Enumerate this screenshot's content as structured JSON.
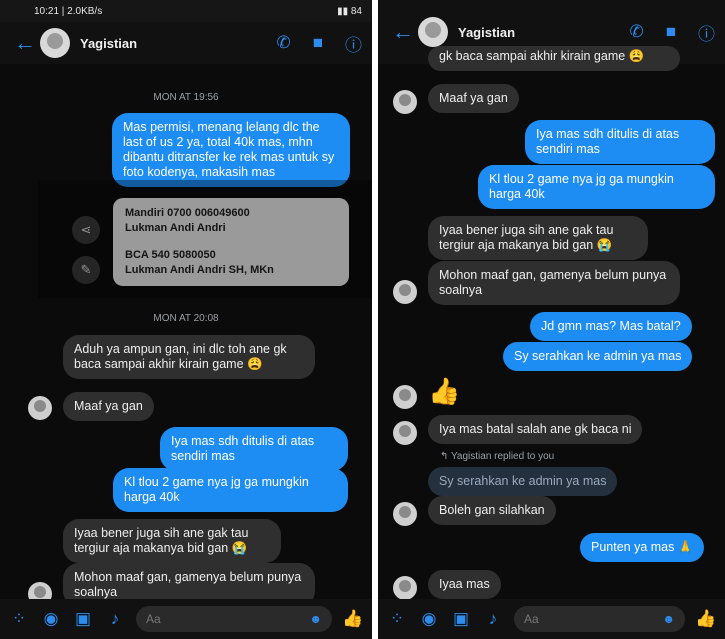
{
  "status": {
    "time": "10:21 | 2.0KB/s",
    "battery": "84"
  },
  "contact": {
    "name": "Yagistian"
  },
  "left": {
    "time1": "MON AT 19:56",
    "msg1": "Mas permisi, menang lelang dlc the last of us 2 ya, total 40k mas, mhn dibantu ditransfer ke rek mas untuk sy foto kodenya, makasih mas",
    "card": [
      "Mandiri 0700 006049600",
      "Lukman Andi Andri",
      "",
      "BCA 540 5080050",
      "Lukman Andi Andri SH, MKn"
    ],
    "time2": "MON AT 20:08",
    "msg2": "Aduh ya ampun gan, ini dlc toh ane gk baca sampai akhir kirain game 😩",
    "msg3": "Maaf ya gan",
    "msg4": "Iya mas sdh ditulis di atas sendiri mas",
    "msg5": "Kl tlou 2 game nya jg ga mungkin harga 40k",
    "msg6": "Iyaa bener juga sih ane gak tau tergiur aja makanya bid gan 😭",
    "msg7": "Mohon maaf gan, gamenya belum punya soalnya"
  },
  "right": {
    "msg0": "gk baca sampai akhir kirain game 😩",
    "msg1": "Maaf ya gan",
    "msg2": "Iya mas sdh ditulis di atas sendiri mas",
    "msg3": "Kl tlou 2 game nya jg ga mungkin harga 40k",
    "msg4": "Iyaa bener juga sih ane gak tau tergiur aja makanya bid gan 😭",
    "msg5": "Mohon maaf gan, gamenya belum punya soalnya",
    "msg6": "Jd gmn mas? Mas batal?",
    "msg7": "Sy serahkan ke admin ya mas",
    "msg8": "Iya mas batal salah ane gk baca ni",
    "reply_note": "Yagistian replied to you",
    "quoted": "Sy serahkan ke admin ya mas",
    "msg9": "Boleh gan silahkan",
    "msg10": "Punten ya mas 🙏",
    "msg11": "Iyaa mas"
  },
  "composer": {
    "placeholder": "Aa"
  },
  "icons": [
    "back-arrow-icon",
    "phone-icon",
    "video-icon",
    "info-icon",
    "share-icon",
    "edit-icon",
    "apps-icon",
    "camera-icon",
    "image-icon",
    "mic-icon",
    "emoji-icon",
    "like-icon"
  ],
  "colors": {
    "accent": "#1d8cf3",
    "background": "#0b0b0b",
    "incoming": "#2f2f2f"
  }
}
